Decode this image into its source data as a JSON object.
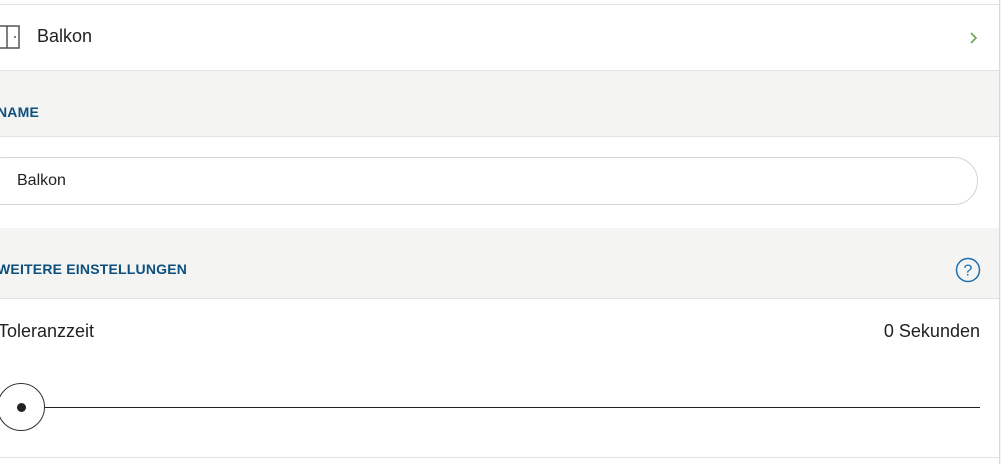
{
  "device": {
    "label": "Balkon",
    "icon": "window-door-icon",
    "chevron_icon": "chevron-right-icon",
    "chevron_color": "#6aa84f"
  },
  "name_section": {
    "title": "NAME",
    "input_value": "Balkon"
  },
  "settings_section": {
    "title": "WEITERE EINSTELLUNGEN",
    "help_icon": "help-icon"
  },
  "tolerance": {
    "label": "Toleranzzeit",
    "value_text": "0 Sekunden",
    "slider_value": 0
  },
  "colors": {
    "accent_blue": "#0d4f7d",
    "section_bg": "#f4f4f2",
    "help_blue": "#1e6fae"
  }
}
